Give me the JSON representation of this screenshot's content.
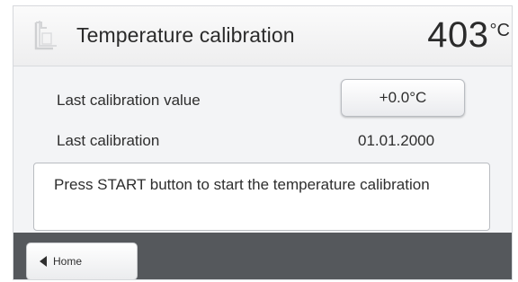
{
  "header": {
    "icon": "furnace-icon",
    "title": "Temperature calibration",
    "temperature": "403",
    "temperature_unit": "°C"
  },
  "calibration": {
    "last_value_label": "Last calibration value",
    "last_value": "+0.0°C",
    "last_date_label": "Last calibration",
    "last_date": "01.01.2000"
  },
  "message": "Press START button to start the temperature calibration",
  "footer": {
    "home_icon": "arrow-left-icon",
    "home_label": "Home"
  },
  "colors": {
    "footer_bar": "#55585c",
    "background": "#f2f3f5"
  }
}
